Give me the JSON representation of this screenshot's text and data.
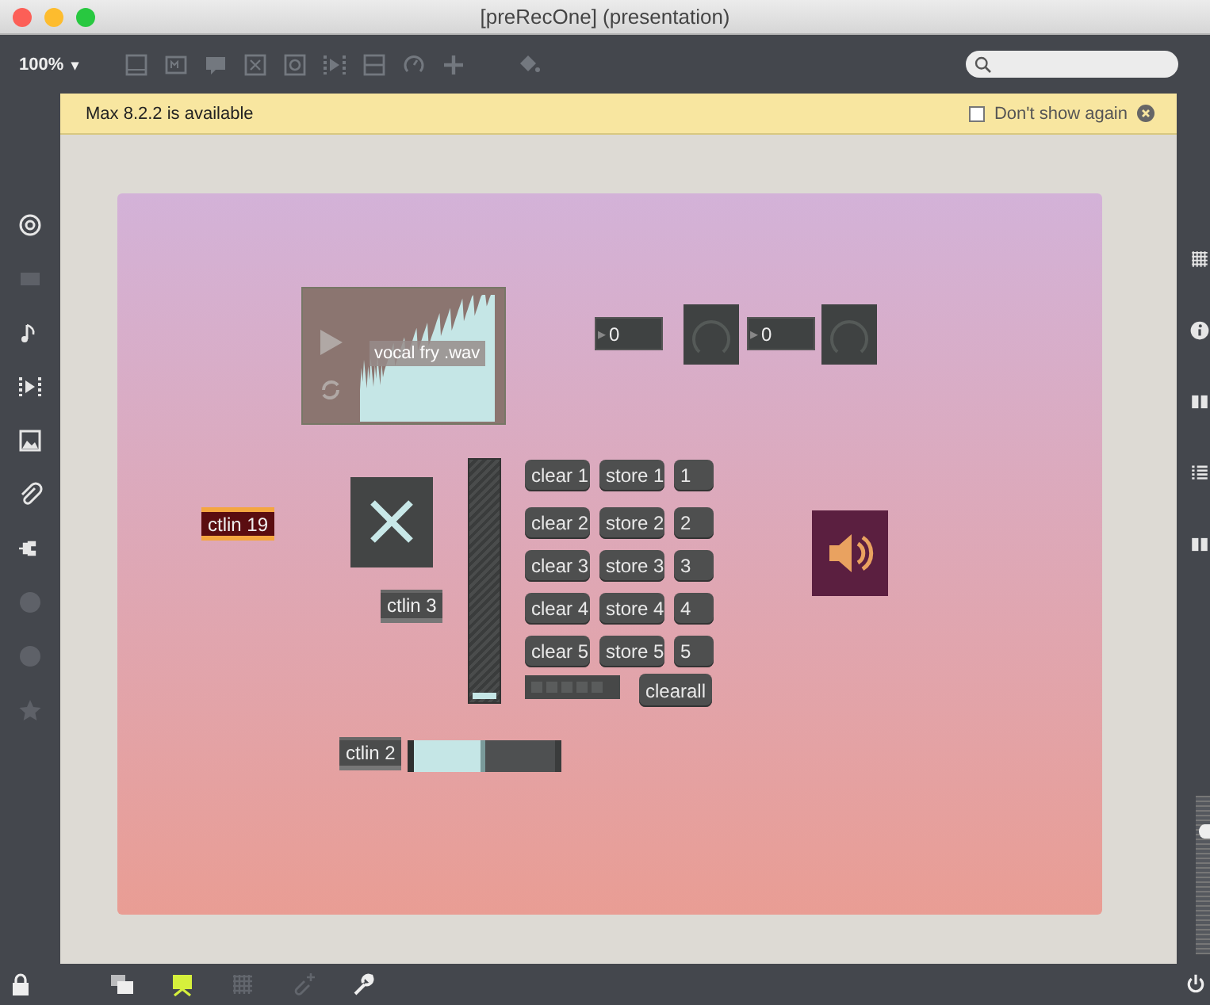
{
  "window": {
    "title": "[preRecOne] (presentation)"
  },
  "toolbar": {
    "zoom": "100%",
    "zoom_caret": "▾",
    "icons": [
      {
        "kind": "panel"
      },
      {
        "kind": "message"
      },
      {
        "kind": "comment"
      },
      {
        "kind": "toggle"
      },
      {
        "kind": "button"
      },
      {
        "kind": "play"
      },
      {
        "kind": "slider"
      },
      {
        "kind": "dial"
      },
      {
        "kind": "plus"
      },
      {
        "kind": "bucket"
      }
    ]
  },
  "banner": {
    "text": "Max 8.2.2 is available",
    "dont_show": {
      "label": "Don't show again",
      "checked": false
    }
  },
  "left_sidebar": [
    {
      "kind": "target",
      "disabled": false
    },
    {
      "kind": "film",
      "disabled": true
    },
    {
      "kind": "note",
      "disabled": false
    },
    {
      "kind": "play",
      "disabled": false
    },
    {
      "kind": "image",
      "disabled": false
    },
    {
      "kind": "clip",
      "disabled": false
    },
    {
      "kind": "plug",
      "disabled": false
    },
    {
      "kind": "circle",
      "disabled": true
    },
    {
      "kind": "circle",
      "disabled": true
    },
    {
      "kind": "star",
      "disabled": true
    }
  ],
  "right_sidebar": [
    {
      "kind": "grid"
    },
    {
      "kind": "info"
    },
    {
      "kind": "book"
    },
    {
      "kind": "list"
    },
    {
      "kind": "book"
    }
  ],
  "zoom_slider": {
    "level": 0.8
  },
  "patch": {
    "objects": [
      {
        "kind": "waveform",
        "label": "vocal fry .wav"
      },
      {
        "kind": "number",
        "value": "0",
        "arrow": "▸"
      },
      {
        "kind": "dial"
      },
      {
        "kind": "number",
        "value": "0",
        "arrow": "▸"
      },
      {
        "kind": "dial"
      },
      {
        "kind": "ctlin",
        "label": "ctlin 19",
        "selected": true
      },
      {
        "kind": "toggle",
        "on": true
      },
      {
        "kind": "ctlin",
        "label": "ctlin 3",
        "selected": false
      },
      {
        "kind": "vslider",
        "level": 0.02
      },
      {
        "kind": "presets",
        "rows": [
          {
            "clear": "clear 1",
            "store": "store 1",
            "slot": "1"
          },
          {
            "clear": "clear 2",
            "store": "store 2",
            "slot": "2"
          },
          {
            "clear": "clear 3",
            "store": "store 3",
            "slot": "3"
          },
          {
            "clear": "clear 4",
            "store": "store 4",
            "slot": "4"
          },
          {
            "clear": "clear 5",
            "store": "store 5",
            "slot": "5"
          }
        ],
        "clearall": "clearall"
      },
      {
        "kind": "speaker"
      },
      {
        "kind": "ctlin",
        "label": "ctlin 2",
        "selected": false
      },
      {
        "kind": "hslider",
        "level": 0.5
      }
    ]
  },
  "bottom_bar": [
    {
      "kind": "lock",
      "selected": false
    },
    {
      "kind": "windows",
      "selected": false
    },
    {
      "kind": "presentation",
      "selected": true
    },
    {
      "kind": "grid",
      "selected": false
    },
    {
      "kind": "clip-plus",
      "selected": false
    },
    {
      "kind": "wrench",
      "selected": false
    }
  ]
}
